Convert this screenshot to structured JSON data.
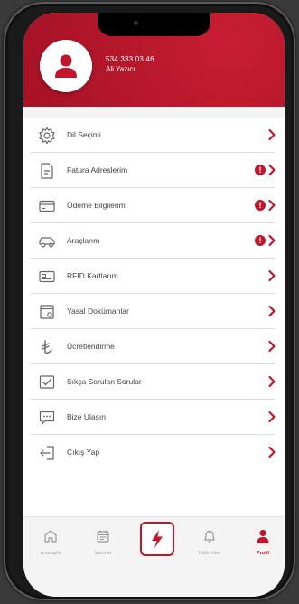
{
  "user": {
    "phone": "534 333 03 46",
    "name": "Ali Yazıcı"
  },
  "menu": [
    {
      "label": "Dil Seçimi",
      "icon": "gear-icon",
      "warning": false
    },
    {
      "label": "Fatura Adreslerim",
      "icon": "invoice-icon",
      "warning": true
    },
    {
      "label": "Ödeme Bilgilerim",
      "icon": "credit-card-icon",
      "warning": true
    },
    {
      "label": "Araçlarım",
      "icon": "car-icon",
      "warning": true
    },
    {
      "label": "RFID Kartlarım",
      "icon": "rfid-card-icon",
      "warning": false
    },
    {
      "label": "Yasal Dokümanlar",
      "icon": "document-icon",
      "warning": false
    },
    {
      "label": "Ücretlendirme",
      "icon": "lira-icon",
      "warning": false
    },
    {
      "label": "Sıkça Sorulan Sorular",
      "icon": "faq-icon",
      "warning": false
    },
    {
      "label": "Bize Ulaşın",
      "icon": "chat-icon",
      "warning": false
    },
    {
      "label": "Çıkış Yap",
      "icon": "logout-icon",
      "warning": false
    }
  ],
  "warning_glyph": "!",
  "tabs": {
    "home": "Anasayfa",
    "jobs": "İşlemler",
    "notifications": "Bildirimler",
    "profile": "Profil"
  },
  "colors": {
    "brand": "#c0172c",
    "text": "#444444",
    "muted": "#aaaaaa"
  }
}
